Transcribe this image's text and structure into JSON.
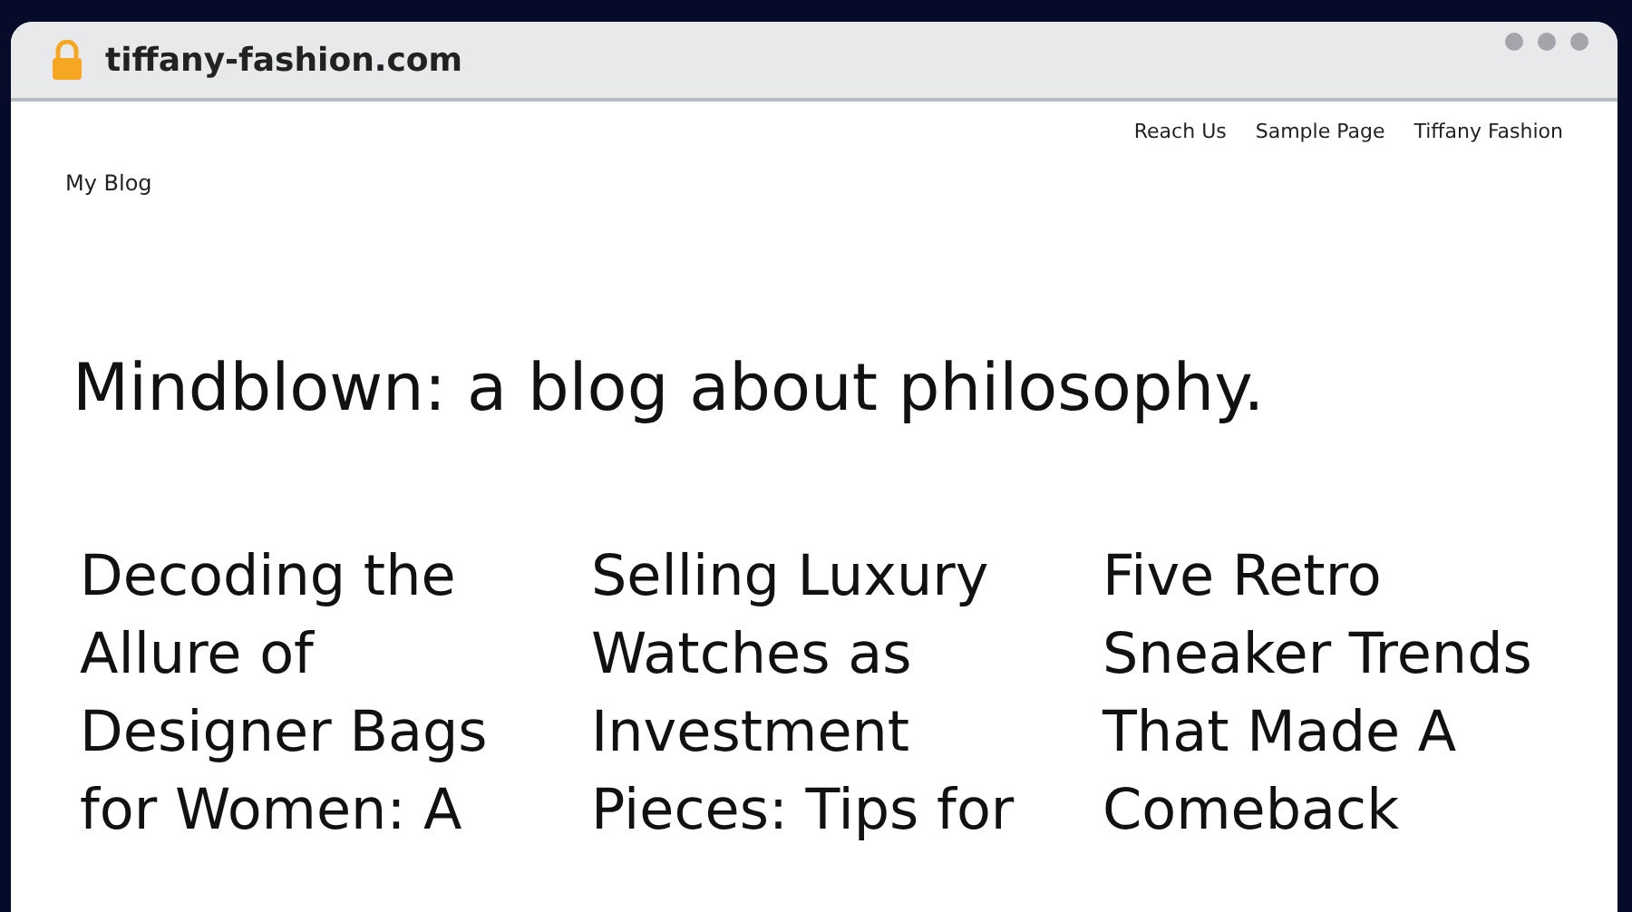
{
  "browser": {
    "address": "tiffany-fashion.com"
  },
  "site": {
    "title": "My Blog",
    "nav": [
      {
        "label": "Reach Us"
      },
      {
        "label": "Sample Page"
      },
      {
        "label": "Tiffany Fashion"
      }
    ],
    "tagline": "Mindblown: a blog about philosophy."
  },
  "posts": [
    {
      "title": "Decoding the Allure of Designer Bags for Women: A"
    },
    {
      "title": "Selling Luxury Watches as Investment Pieces: Tips for"
    },
    {
      "title": "Five Retro Sneaker Trends That Made A Comeback"
    }
  ]
}
